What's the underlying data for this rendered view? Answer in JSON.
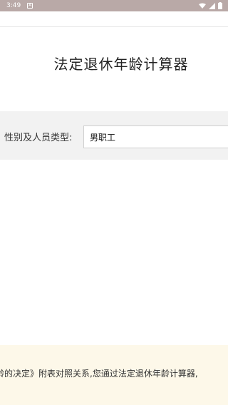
{
  "status_bar": {
    "time": "3:49",
    "notification_glyph": "A",
    "icons": [
      "wifi-icon",
      "signal-icon",
      "battery-icon"
    ]
  },
  "page": {
    "title": "法定退休年龄计算器"
  },
  "form": {
    "gender_label": "性别及人员类型:",
    "gender_value": "男职工"
  },
  "note": {
    "text": "龄的决定》附表对照关系,您通过法定退休年龄计算器,"
  }
}
